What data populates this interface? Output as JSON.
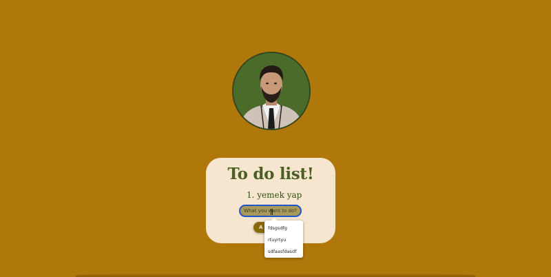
{
  "page": {
    "background_color": "#b0780a"
  },
  "profile": {
    "avatar_icon": "profile-photo"
  },
  "card": {
    "title": "To do list!",
    "tasks": [
      {
        "number": "1.",
        "text": "yemek yap"
      }
    ],
    "input": {
      "value": "",
      "placeholder": "What you want to do?"
    },
    "add_button_label": "A"
  },
  "autocomplete": {
    "suggestions": [
      "fdsgsdfg",
      "rtuyrtyu",
      "sdfaasfdasdf"
    ]
  },
  "colors": {
    "card_background": "#f6e5cf",
    "title_color": "#4b5f25",
    "input_border": "#1e56c9",
    "button_background": "#8a6a08"
  }
}
